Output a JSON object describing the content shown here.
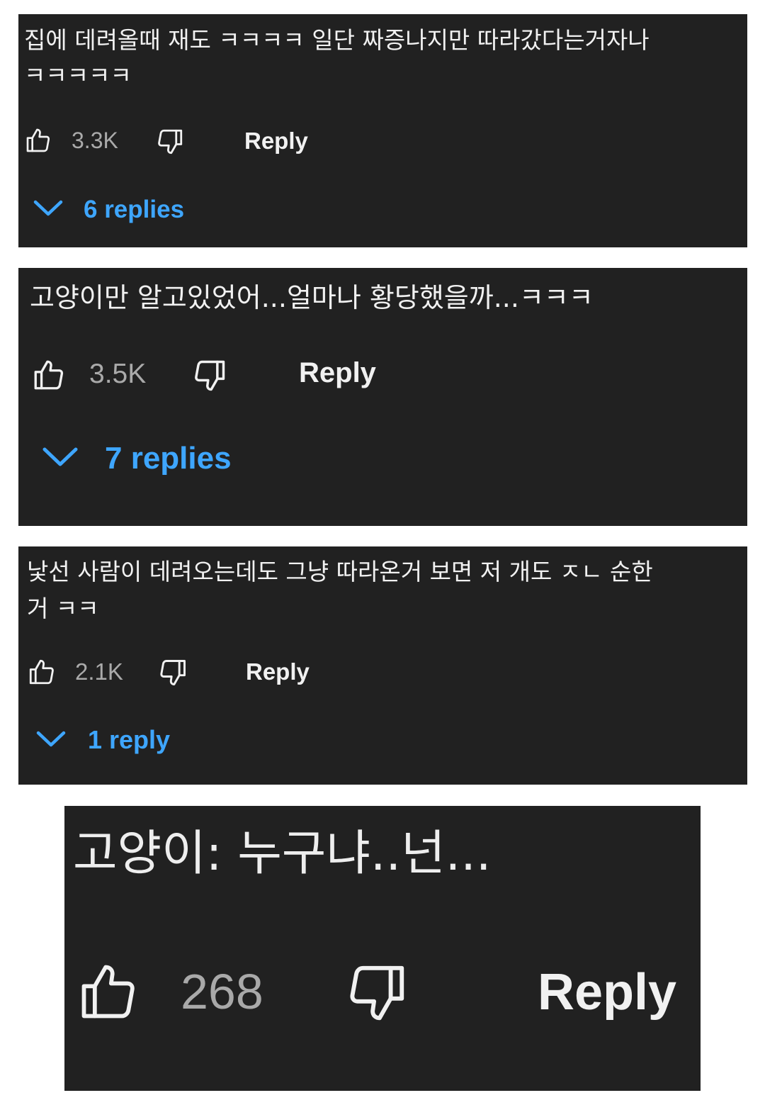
{
  "comments": [
    {
      "text": "집에 데려올때 재도 ㅋㅋㅋㅋ 일단 짜증나지만 따라갔다는거자나\nㅋㅋㅋㅋㅋ",
      "likes": "3.3K",
      "reply_label": "Reply",
      "replies_label": "6 replies"
    },
    {
      "text": "고양이만 알고있었어...얼마나 황당했을까...ㅋㅋㅋ",
      "likes": "3.5K",
      "reply_label": "Reply",
      "replies_label": "7 replies"
    },
    {
      "text": "낯선 사람이 데려오는데도 그냥 따라온거 보면 저 개도 ㅈㄴ 순한\n거 ㅋㅋ",
      "likes": "2.1K",
      "reply_label": "Reply",
      "replies_label": "1 reply"
    },
    {
      "text": "고양이: 누구냐..넌...",
      "likes": "268",
      "reply_label": "Reply"
    }
  ],
  "colors": {
    "card_bg": "#212121",
    "text": "#f1f1f1",
    "count": "#aaaaaa",
    "link": "#3ea6ff"
  },
  "icons": {
    "like": "thumbs-up-icon",
    "dislike": "thumbs-down-icon",
    "expand": "chevron-down-icon"
  }
}
